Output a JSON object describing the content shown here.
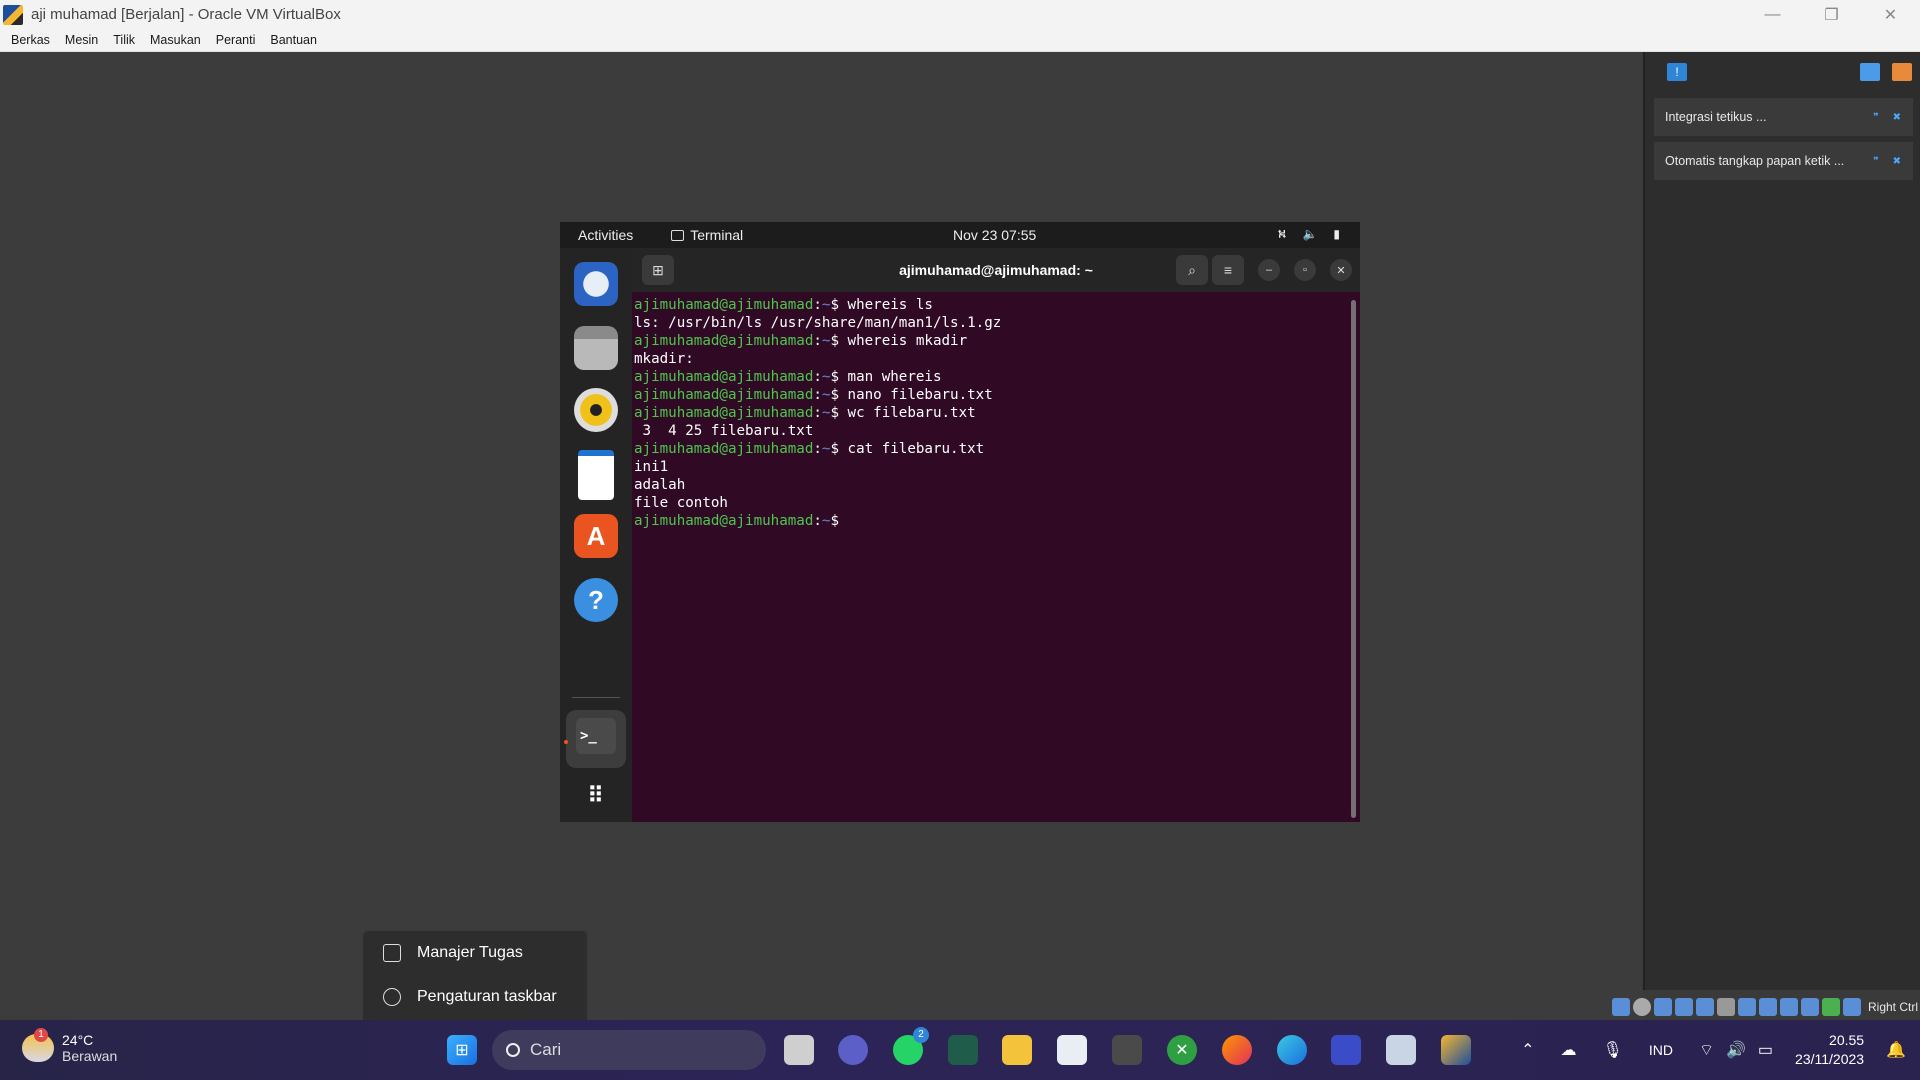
{
  "host": {
    "window_title": "aji muhamad  [Berjalan] - Oracle VM VirtualBox",
    "controls": {
      "minimize": "—",
      "restore": "❐",
      "close": "✕"
    },
    "menu": [
      "Berkas",
      "Mesin",
      "Tilik",
      "Masukan",
      "Peranti",
      "Bantuan"
    ]
  },
  "notifications": {
    "items": [
      {
        "label": "Integrasi tetikus ..."
      },
      {
        "label": "Otomatis tangkap papan ketik ..."
      }
    ],
    "host_key": "Right Ctrl"
  },
  "guest": {
    "topbar": {
      "activities": "Activities",
      "app": "Terminal",
      "clock": "Nov 23  07:55"
    },
    "dock": [
      "thunderbird-icon",
      "files-icon",
      "rhythmbox-icon",
      "writer-icon",
      "software-icon",
      "help-icon",
      "terminal-icon",
      "apps-grid-icon"
    ],
    "terminal": {
      "title": "ajimuhamad@ajimuhamad: ~",
      "prompt": "ajimuhamad@ajimuhamad",
      "lines": [
        {
          "p": true,
          "cmd": " whereis ls"
        },
        {
          "p": false,
          "out": "ls: /usr/bin/ls /usr/share/man/man1/ls.1.gz"
        },
        {
          "p": true,
          "cmd": " whereis mkadir"
        },
        {
          "p": false,
          "out": "mkadir:"
        },
        {
          "p": true,
          "cmd": " man whereis"
        },
        {
          "p": true,
          "cmd": " nano filebaru.txt"
        },
        {
          "p": true,
          "cmd": " wc filebaru.txt"
        },
        {
          "p": false,
          "out": " 3  4 25 filebaru.txt"
        },
        {
          "p": true,
          "cmd": " cat filebaru.txt"
        },
        {
          "p": false,
          "out": "ini1"
        },
        {
          "p": false,
          "out": "adalah"
        },
        {
          "p": false,
          "out": "file contoh"
        },
        {
          "p": true,
          "cmd": " "
        }
      ]
    }
  },
  "context_menu": {
    "items": [
      "Manajer Tugas",
      "Pengaturan taskbar"
    ]
  },
  "taskbar": {
    "weather": {
      "temp": "24°C",
      "desc": "Berawan",
      "badge": "1"
    },
    "search_placeholder": "Cari",
    "whatsapp_badge": "2",
    "lang": "IND",
    "time": "20.55",
    "date": "23/11/2023"
  }
}
